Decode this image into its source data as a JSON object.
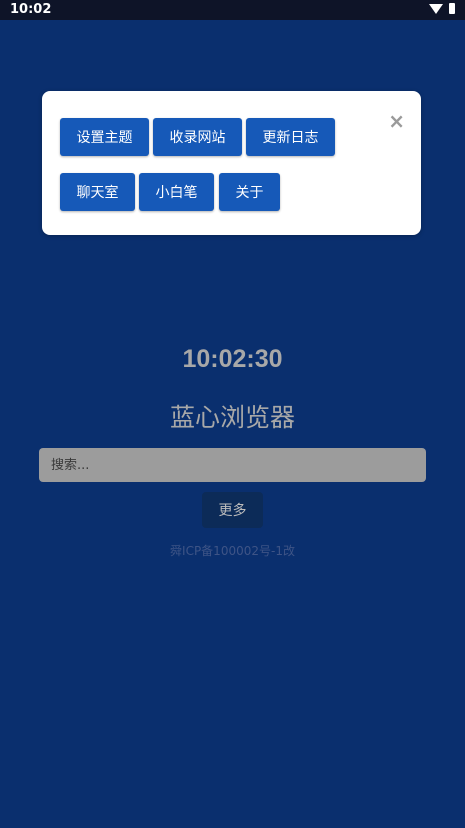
{
  "status_bar": {
    "time": "10:02",
    "icons": [
      "wifi-icon",
      "battery-icon"
    ]
  },
  "menu_popup": {
    "close_symbol": "×",
    "buttons": [
      {
        "label": "设置主题"
      },
      {
        "label": "收录网站"
      },
      {
        "label": "更新日志"
      },
      {
        "label": "聊天室"
      },
      {
        "label": "小白笔"
      },
      {
        "label": "关于"
      }
    ]
  },
  "main": {
    "clock": "10:02:30",
    "app_title": "蓝心浏览器",
    "search_placeholder": "搜索...",
    "more_label": "更多",
    "icp_text": "舜ICP备100002号-1改"
  },
  "colors": {
    "background": "#0a2f6e",
    "button": "#1659b8",
    "more_button": "#0c2b58",
    "search_bg": "#9c9c9c"
  }
}
